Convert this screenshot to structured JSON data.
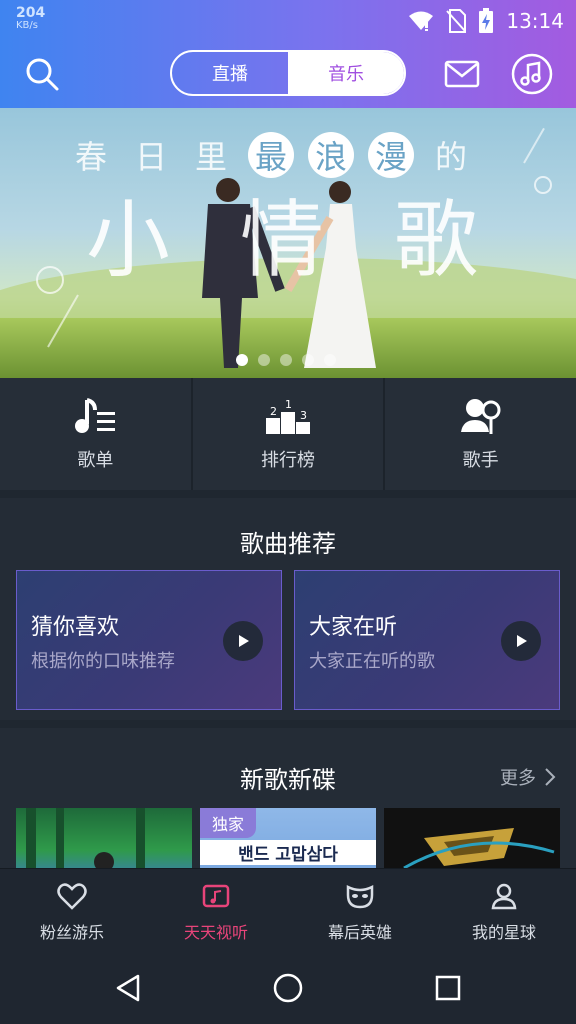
{
  "status_bar": {
    "speed_value": "204",
    "speed_unit": "KB/s",
    "time": "13:14"
  },
  "header": {
    "tabs": [
      {
        "label": "直播",
        "active": false
      },
      {
        "label": "音乐",
        "active": true
      }
    ]
  },
  "banner": {
    "line1": [
      "春",
      "日",
      "里",
      "最",
      "浪",
      "漫",
      "的"
    ],
    "line1_highlighted": [
      "最",
      "浪",
      "漫"
    ],
    "line2": [
      "小",
      "情",
      "歌"
    ],
    "slide_count": 5,
    "active_slide": 1
  },
  "quick_nav": [
    {
      "label": "歌单",
      "icon": "playlist-icon"
    },
    {
      "label": "排行榜",
      "icon": "podium-icon",
      "podium_numbers": [
        "2",
        "1",
        "3"
      ]
    },
    {
      "label": "歌手",
      "icon": "singer-icon"
    }
  ],
  "recommend": {
    "title": "歌曲推荐",
    "cards": [
      {
        "title": "猜你喜欢",
        "subtitle": "根据你的口味推荐"
      },
      {
        "title": "大家在听",
        "subtitle": "大家正在听的歌"
      }
    ]
  },
  "new_releases": {
    "title": "新歌新碟",
    "more_label": "更多",
    "albums": [
      {
        "badge": "",
        "caption": ""
      },
      {
        "badge": "独家",
        "caption": "밴드 고맙삼다"
      },
      {
        "badge": "",
        "caption": ""
      }
    ]
  },
  "bottom_tabs": [
    {
      "label": "粉丝游乐",
      "icon": "heart-icon",
      "active": false
    },
    {
      "label": "天天视听",
      "icon": "music-video-icon",
      "active": true
    },
    {
      "label": "幕后英雄",
      "icon": "mask-icon",
      "active": false
    },
    {
      "label": "我的星球",
      "icon": "profile-icon",
      "active": false
    }
  ],
  "colors": {
    "accent": "#e8447a",
    "segment_active_text": "#a04fe0",
    "header_gradient_start": "#3f84f0",
    "header_gradient_end": "#a35be0"
  }
}
